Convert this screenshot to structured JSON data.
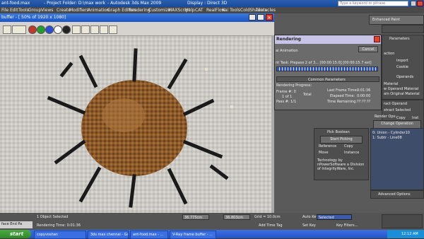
{
  "app_title": {
    "left": "ant-food.max",
    "project": "- Project Folder: D:\\max work",
    "product": "- Autodesk 3ds Max  2009",
    "display": "Display : Direct 3D",
    "search_placeholder": "Type a keyword or phrase"
  },
  "menu": [
    "File",
    "Edit",
    "Tools",
    "Group",
    "Views",
    "Create",
    "Modifiers",
    "Animation",
    "Graph Editors",
    "Rendering",
    "Customize",
    "MAXScript",
    "Help",
    "CAT",
    "RealFlow",
    "Kai Tools",
    "ColdShaders",
    "Tentacles"
  ],
  "framebuffer": {
    "title": "buffer - [ 50% of 1920 x 1080]",
    "colors": [
      "#c0392b",
      "#1fa02c",
      "#2a4fd6",
      "#ffffff",
      "#222222"
    ]
  },
  "render_dialog": {
    "title": "Rendering",
    "cancel": "Cancel",
    "animation_label": "al Animation",
    "current_task": "nt Task:   Prepass 2 of 3... [00:00:15.0] [00:00:15.7 est]",
    "common_parameters": "Common Parameters",
    "rendering_progress": "Rendering Progress:",
    "frame_num": "Frame #:  0",
    "frame_of": "1 of 1",
    "frame_total": "Total",
    "passes": "Pass #:  1/1",
    "last_frame_time": "Last Frame Time:",
    "last_frame_value": "0:01:36",
    "elapsed_time": "Elapsed Time:",
    "elapsed_value": "0:00:00",
    "time_remaining": "Time Remaining:",
    "time_remaining_value": "??:??:??"
  },
  "right_panel": {
    "top_field": "Enhanced Paint",
    "parameters": "Parameters",
    "opt_action": "action",
    "opt_import": "Import",
    "opt_cookie": "Cookie",
    "operands": "Operands",
    "material_header": "Material",
    "operand_material": "w Operand Material",
    "original_material": "ain Original Material",
    "extract_operand": "ract Operand",
    "extract_selected": "xtract Selected",
    "render_ops": "Render Ops:",
    "copy": "Copy",
    "inst": "Inst",
    "change_operation": "Change Operation",
    "pick_boolean": "Pick Boolean",
    "start_picking": "Start Picking",
    "reference": "Reference",
    "copy2": "Copy",
    "move": "Move",
    "instance": "Instance",
    "list_items": [
      "0: Union - Cylinder10",
      "1: Subtr - Line08"
    ],
    "credit": "Technology by nPowerSoftware a Division of IntegrityWare, Inc.",
    "advanced_options": "Advanced Options"
  },
  "status": {
    "selected": "1 Object Selected",
    "rendering_time": "Rendering Time: 0:01:36",
    "left_label": "face End Pa",
    "x_value": "36.775cm",
    "y_value": "36.803cm",
    "grid": "Grid = 10.0cm",
    "add_time_tag": "Add Time Tag",
    "auto_key": "Auto Key",
    "selected_dropdown": "Selected",
    "set_key": "Set Key",
    "key_filters": "Key Filters..."
  },
  "taskbar": {
    "start": "start",
    "tasks": [
      "copyvoshan",
      "3ds max chennai - Go...",
      "ant-food.max - ...",
      "V-Ray frame buffer - ..."
    ],
    "time": "12:12 AM"
  }
}
